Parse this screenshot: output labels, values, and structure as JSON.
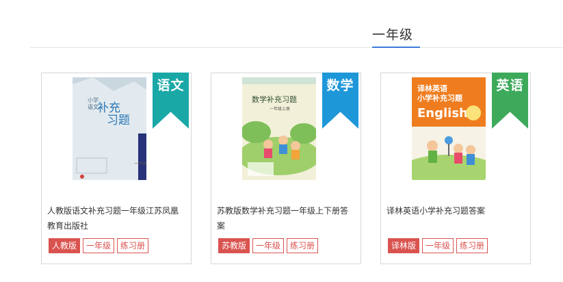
{
  "header": {
    "grade_title": "一年级"
  },
  "cards": [
    {
      "subject": "语文",
      "ribbon_color": "#1aa8a7",
      "cover": {
        "line1": "小学",
        "line2": "语文",
        "title1": "补充",
        "title2": "习题",
        "grade_mark": "一年级"
      },
      "title": "人教版语文补充习题一年级江苏凤凰教育出版社",
      "tags": [
        "人教版",
        "一年级",
        "练习册"
      ]
    },
    {
      "subject": "数学",
      "ribbon_color": "#1e97d9",
      "cover": {
        "title": "数学补充习题",
        "sub": "一年级上册"
      },
      "title": "苏教版数学补充习题一年级上下册答案",
      "tags": [
        "苏教版",
        "一年级",
        "练习册"
      ]
    },
    {
      "subject": "英语",
      "ribbon_color": "#3daa5b",
      "cover": {
        "line1": "译林英语",
        "line2": "小学补充习题",
        "brand": "English"
      },
      "title": "译林英语小学补充习题答案",
      "tags": [
        "译林版",
        "一年级",
        "练习册"
      ]
    }
  ],
  "colors": {
    "tag_red": "#d9534f",
    "accent_blue": "#3b7ad9"
  }
}
